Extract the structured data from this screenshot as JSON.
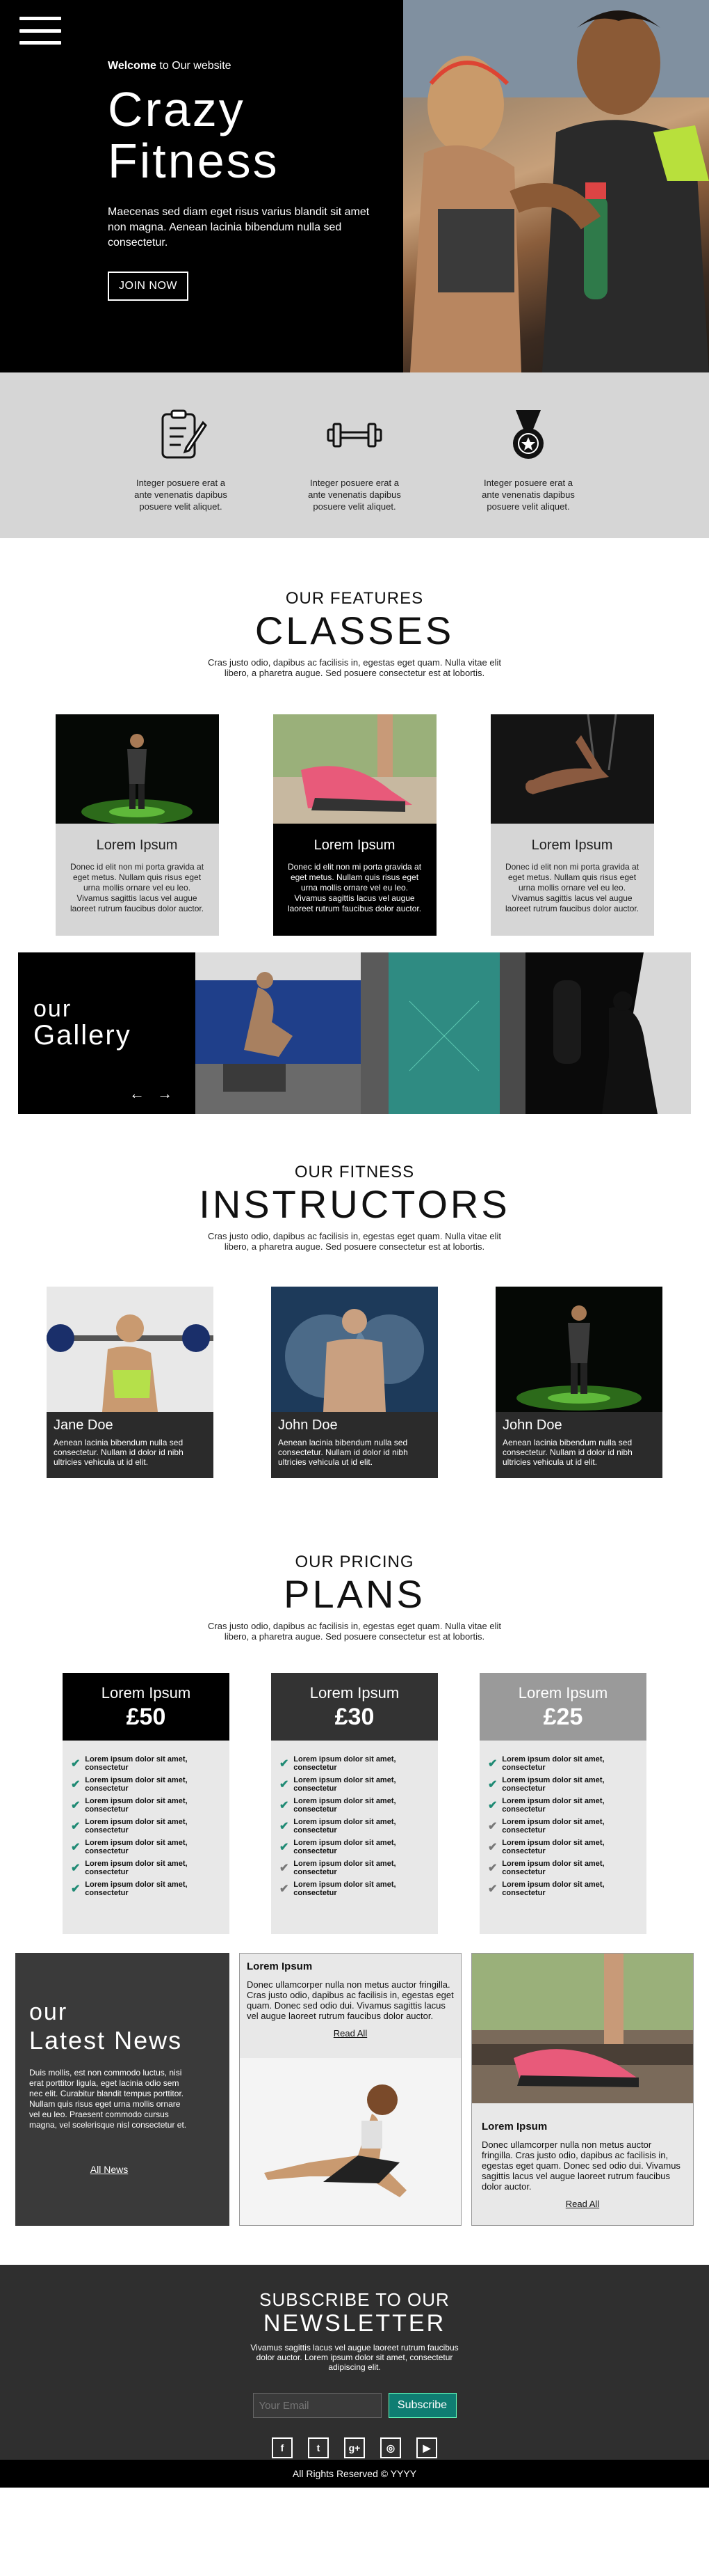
{
  "hero": {
    "welcome_bold": "Welcome",
    "welcome_rest": " to Our website",
    "title_line1": "Crazy",
    "title_line2": "Fitness",
    "description": "Maecenas sed diam eget risus varius blandit sit amet non magna. Aenean lacinia bibendum nulla sed consectetur.",
    "cta": "JOIN NOW"
  },
  "features": {
    "items": [
      {
        "icon": "clipboard-icon",
        "text": "Integer posuere erat a ante venenatis dapibus posuere velit aliquet."
      },
      {
        "icon": "dumbbell-icon",
        "text": "Integer posuere erat a ante venenatis dapibus posuere velit aliquet."
      },
      {
        "icon": "medal-icon",
        "text": "Integer posuere erat a ante venenatis dapibus posuere velit aliquet."
      }
    ]
  },
  "classes": {
    "kicker": "OUR FEATURES",
    "title": "CLASSES",
    "description": "Cras justo odio, dapibus ac facilisis in, egestas eget quam. Nulla vitae elit libero, a pharetra augue. Sed posuere consectetur est at lobortis.",
    "cards": [
      {
        "title": "Lorem Ipsum",
        "text": "Donec id elit non mi porta gravida at eget metus. Nullam quis risus eget urna mollis ornare vel eu leo. Vivamus sagittis lacus vel augue laoreet rutrum faucibus dolor auctor."
      },
      {
        "title": "Lorem Ipsum",
        "text": "Donec id elit non mi porta gravida at eget metus. Nullam quis risus eget urna mollis ornare vel eu leo. Vivamus sagittis lacus vel augue laoreet rutrum faucibus dolor auctor."
      },
      {
        "title": "Lorem Ipsum",
        "text": "Donec id elit non mi porta gravida at eget metus. Nullam quis risus eget urna mollis ornare vel eu leo. Vivamus sagittis lacus vel augue laoreet rutrum faucibus dolor auctor."
      }
    ]
  },
  "gallery": {
    "our": "our",
    "title": "Gallery",
    "prev": "←",
    "next": "→"
  },
  "instructors": {
    "kicker": "OUR FITNESS",
    "title": "INSTRUCTORS",
    "description": "Cras justo odio, dapibus ac facilisis in, egestas eget quam. Nulla vitae elit libero, a pharetra augue. Sed posuere consectetur est at lobortis.",
    "cards": [
      {
        "name": "Jane Doe",
        "text": "Aenean lacinia bibendum nulla sed consectetur. Nullam id dolor id nibh ultricies vehicula ut id elit."
      },
      {
        "name": "John Doe",
        "text": "Aenean lacinia bibendum nulla sed consectetur. Nullam id dolor id nibh ultricies vehicula ut id elit."
      },
      {
        "name": "John Doe",
        "text": "Aenean lacinia bibendum nulla sed consectetur. Nullam id dolor id nibh ultricies vehicula ut id elit."
      }
    ]
  },
  "plans": {
    "kicker": "OUR PRICING",
    "title": "PLANS",
    "description": "Cras justo odio, dapibus ac facilisis in, egestas eget quam. Nulla vitae elit libero, a pharetra augue. Sed posuere consectetur est at lobortis.",
    "feature_text": "Lorem ipsum dolor sit amet, consectetur",
    "cards": [
      {
        "name": "Lorem Ipsum",
        "price": "£50",
        "checked": [
          true,
          true,
          true,
          true,
          true,
          true,
          true
        ]
      },
      {
        "name": "Lorem Ipsum",
        "price": "£30",
        "checked": [
          true,
          true,
          true,
          true,
          true,
          false,
          false
        ]
      },
      {
        "name": "Lorem Ipsum",
        "price": "£25",
        "checked": [
          true,
          true,
          true,
          false,
          false,
          false,
          false
        ]
      }
    ]
  },
  "news": {
    "our": "our",
    "title": "Latest News",
    "description": "Duis mollis, est non commodo luctus, nisi erat porttitor ligula, eget lacinia odio sem nec elit. Curabitur blandit tempus porttitor. Nullam quis risus eget urna mollis ornare vel eu leo. Praesent commodo cursus magna, vel scelerisque nisl consectetur et.",
    "description_short": "Duis mollis, est non commodo luctus, nisi erat porttitor ligula, eget lacinia odio sem nec elit. Curabitur blandit tempus porttitor. Nullam quis risus eget urna mollis ornare vel eu leo. Praesent commodo cursus magna, vel scelerisque nisl consectetur et.",
    "all_link": "All News",
    "cards": [
      {
        "title": "Lorem Ipsum",
        "text": "Donec ullamcorper nulla non metus auctor fringilla. Cras justo odio, dapibus ac facilisis in, egestas eget quam. Donec sed odio dui. Vivamus sagittis lacus vel augue laoreet rutrum faucibus dolor auctor.",
        "link": "Read All"
      },
      {
        "title": "Lorem Ipsum",
        "text": "Donec ullamcorper nulla non metus auctor fringilla. Cras justo odio, dapibus ac facilisis in, egestas eget quam. Donec sed odio dui. Vivamus sagittis lacus vel augue laoreet rutrum faucibus dolor auctor.",
        "link": "Read All"
      }
    ]
  },
  "newsletter": {
    "kicker": "SUBSCRIBE TO OUR",
    "title": "NEWSLETTER",
    "description": "Vivamus sagittis lacus vel augue laoreet rutrum faucibus dolor auctor. Lorem ipsum dolor sit amet, consectetur adipiscing elit.",
    "email_placeholder": "Your Email",
    "button": "Subscribe",
    "social": [
      {
        "icon": "facebook-icon",
        "glyph": "f"
      },
      {
        "icon": "twitter-icon",
        "glyph": "t"
      },
      {
        "icon": "google-plus-icon",
        "glyph": "g+"
      },
      {
        "icon": "instagram-icon",
        "glyph": "◎"
      },
      {
        "icon": "youtube-icon",
        "glyph": "▶"
      }
    ],
    "footer": "All Rights Reserved © YYYY"
  },
  "colors": {
    "accent_teal": "#0f7d72",
    "check_green": "#1f8a74",
    "strip_gray": "#d6d6d6",
    "dark": "#2f2f2f"
  }
}
